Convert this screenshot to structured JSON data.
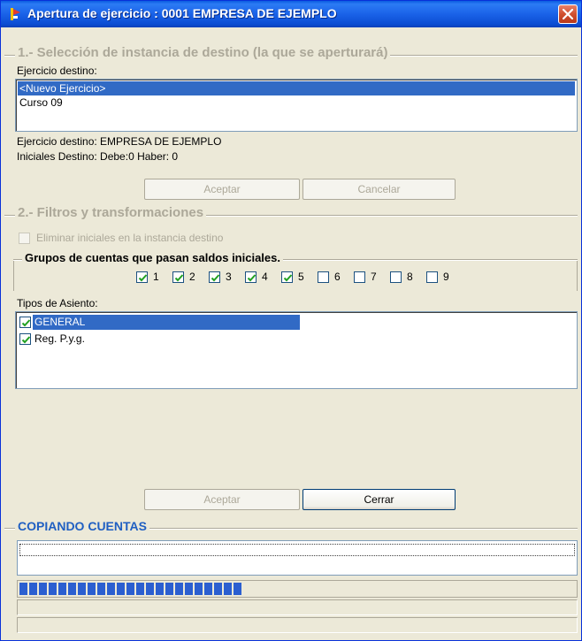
{
  "window": {
    "title": "Apertura de ejercicio : 0001 EMPRESA DE EJEMPLO"
  },
  "section1": {
    "title": "1.- Selección de instancia de destino (la que se aperturará)",
    "list_label": "Ejercicio destino:",
    "items": [
      "<Nuevo Ejercicio>",
      "Curso 09"
    ],
    "selected_index": 0,
    "info_destino": "Ejercicio destino: EMPRESA DE EJEMPLO",
    "info_iniciales": "Iniciales Destino: Debe:0 Haber: 0",
    "accept_label": "Aceptar",
    "cancel_label": "Cancelar"
  },
  "section2": {
    "title": "2.- Filtros y transformaciones",
    "eliminar_label": "Eliminar iniciales en la instancia destino",
    "groups_title": "Grupos de cuentas que pasan saldos iniciales.",
    "groups": [
      {
        "label": "1",
        "checked": true
      },
      {
        "label": "2",
        "checked": true
      },
      {
        "label": "3",
        "checked": true
      },
      {
        "label": "4",
        "checked": true
      },
      {
        "label": "5",
        "checked": true
      },
      {
        "label": "6",
        "checked": false
      },
      {
        "label": "7",
        "checked": false
      },
      {
        "label": "8",
        "checked": false
      },
      {
        "label": "9",
        "checked": false
      }
    ],
    "tipos_label": "Tipos de Asiento:",
    "tipos": [
      {
        "label": "GENERAL",
        "checked": true,
        "selected": true
      },
      {
        "label": "Reg. P.y.g.",
        "checked": true,
        "selected": false
      }
    ],
    "accept_label": "Aceptar",
    "close_label": "Cerrar"
  },
  "progress": {
    "title": "COPIANDO CUENTAS",
    "value_percent": 40
  },
  "colors": {
    "titlebar": "#0A5BE0",
    "selection": "#316AC5",
    "progress": "#2B5FD0",
    "section_title_disabled": "#ACA899",
    "section_title_blue": "#1F5FC2"
  }
}
